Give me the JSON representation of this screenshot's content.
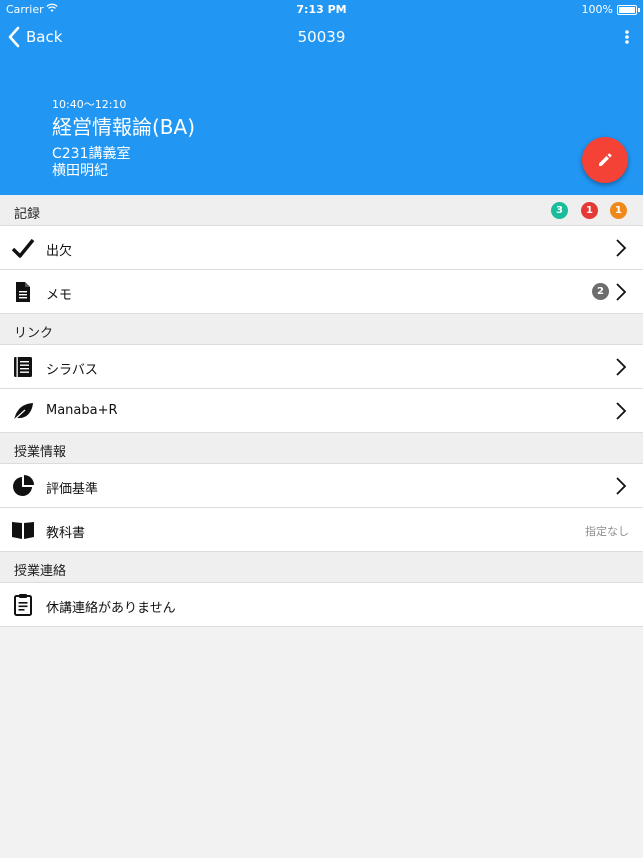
{
  "status_bar": {
    "carrier": "Carrier",
    "time": "7:13 PM",
    "battery": "100%"
  },
  "nav": {
    "back_label": "Back",
    "title": "50039"
  },
  "header": {
    "time_range": "10:40～12:10",
    "course_title": "経営情報論(BA)",
    "room": "C231講義室",
    "teacher": "横田明紀"
  },
  "sections": {
    "records": {
      "title": "記録",
      "badges": [
        {
          "value": "3",
          "color": "#1abc9c"
        },
        {
          "value": "1",
          "color": "#e53935"
        },
        {
          "value": "1",
          "color": "#ef8a1a"
        }
      ],
      "attendance_label": "出欠",
      "memo_label": "メモ",
      "memo_count": "2"
    },
    "links": {
      "title": "リンク",
      "syllabus_label": "シラバス",
      "manaba_label": "Manaba+R"
    },
    "course_info": {
      "title": "授業情報",
      "grading_label": "評価基準",
      "textbook_label": "教科書",
      "textbook_value": "指定なし"
    },
    "notices": {
      "title": "授業連絡",
      "no_cancellation_label": "休講連絡がありません"
    }
  },
  "icons": {
    "attendance": "check-icon",
    "memo": "document-icon",
    "syllabus": "book-list-icon",
    "manaba": "leaf-icon",
    "grading": "pie-chart-icon",
    "textbook": "open-book-icon",
    "notice": "clipboard-icon",
    "fab": "pencil-icon"
  },
  "colors": {
    "primary": "#2196f3",
    "fab": "#f44336",
    "background": "#f2f2f2"
  }
}
